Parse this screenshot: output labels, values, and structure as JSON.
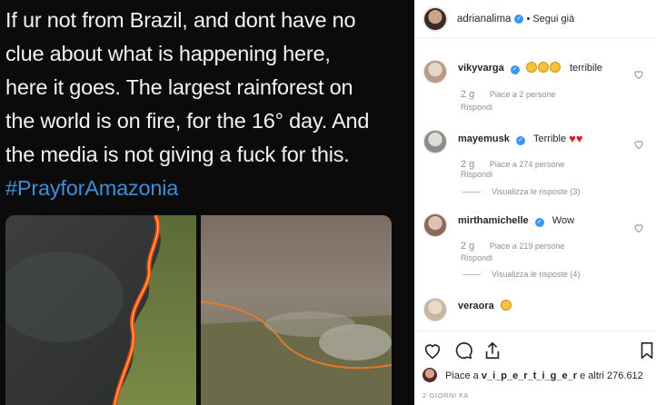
{
  "post": {
    "tweet_lines": [
      "If ur not from Brazil, and dont have no",
      "clue about what is happening here,",
      "here it goes. The largest rainforest on",
      "the world is on fire, for the 16° day. And",
      "the media is not giving a fuck for this."
    ],
    "hashtag": "#PrayforAmazonia"
  },
  "header": {
    "username": "adrianalima",
    "separator": "•",
    "follow_status": "Segui già"
  },
  "comments": [
    {
      "username": "vikyvarga",
      "text": "terribile",
      "time": "2 g",
      "likes": "Piace a 2 persone",
      "reply": "Rispondi",
      "view_replies": ""
    },
    {
      "username": "mayemusk",
      "text": "Terrible",
      "time": "2 g",
      "likes": "Piace a 274 persone",
      "reply": "Rispondi",
      "view_replies": "Visualizza le risposte (3)"
    },
    {
      "username": "mirthamichelle",
      "text": "Wow",
      "time": "2 g",
      "likes": "Piace a 219 persone",
      "reply": "Rispondi",
      "view_replies": "Visualizza le risposte (4)"
    },
    {
      "username": "veraora",
      "text": "",
      "time": "",
      "likes": "",
      "reply": "",
      "view_replies": ""
    }
  ],
  "footer": {
    "likes_prefix": "Piace a",
    "likes_user": "v_i_p_e_r_t_i_g_e_r",
    "likes_suffix": "e altri 276.612",
    "time_ago": "2 GIORNI FA"
  },
  "colors": {
    "verified": "#3897f0",
    "hashtag": "#3b8fd9",
    "heart": "#d81b2a"
  },
  "icons": [
    "heart-icon",
    "comment-icon",
    "share-icon",
    "bookmark-icon",
    "verified-icon"
  ]
}
